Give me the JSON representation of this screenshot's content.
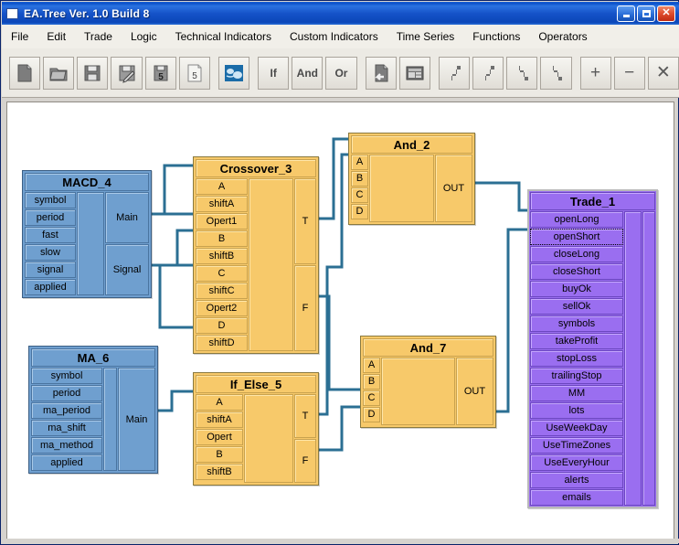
{
  "window": {
    "title": "EA.Tree Ver. 1.0 Build 8",
    "minimize_label": "Minimize",
    "maximize_label": "Maximize",
    "close_label": "Close"
  },
  "menubar": {
    "items": [
      {
        "label": "File"
      },
      {
        "label": "Edit"
      },
      {
        "label": "Trade"
      },
      {
        "label": "Logic"
      },
      {
        "label": "Technical Indicators"
      },
      {
        "label": "Custom Indicators"
      },
      {
        "label": "Time Series"
      },
      {
        "label": "Functions"
      },
      {
        "label": "Operators"
      }
    ]
  },
  "toolbar": {
    "buttons": [
      {
        "icon": "new-file-icon",
        "label": ""
      },
      {
        "icon": "open-folder-icon",
        "label": ""
      },
      {
        "icon": "save-icon",
        "label": ""
      },
      {
        "icon": "save-as-icon",
        "label": ""
      },
      {
        "icon": "save-5-icon",
        "label": "5"
      },
      {
        "icon": "page-5-icon",
        "label": "5"
      },
      {
        "icon": "globe-icon",
        "label": ""
      },
      {
        "icon": "if-icon",
        "label": "If"
      },
      {
        "icon": "and-icon",
        "label": "And"
      },
      {
        "icon": "or-icon",
        "label": "Or"
      },
      {
        "icon": "return-doc-icon",
        "label": ""
      },
      {
        "icon": "table-icon",
        "label": ""
      },
      {
        "icon": "step-up-icon",
        "label": ""
      },
      {
        "icon": "step-up2-icon",
        "label": ""
      },
      {
        "icon": "step-down-icon",
        "label": ""
      },
      {
        "icon": "step-down2-icon",
        "label": ""
      },
      {
        "icon": "plus-icon",
        "label": "+"
      },
      {
        "icon": "minus-icon",
        "label": "−"
      },
      {
        "icon": "delete-x-icon",
        "label": "✕"
      }
    ]
  },
  "colors": {
    "indicator_node": "#6f9fcf",
    "logic_node": "#f7c96a",
    "trade_node": "#9a6ef0",
    "wire": "#2b6f93",
    "titlebar": "#0a50c8",
    "canvas": "#ffffff"
  },
  "canvas": {
    "nodes": [
      {
        "id": "macd4",
        "title": "MACD_4",
        "type": "indicator",
        "inputs": [
          "symbol",
          "period",
          "fast",
          "slow",
          "signal",
          "applied"
        ],
        "outputs": [
          "Main",
          "Signal"
        ]
      },
      {
        "id": "crossover3",
        "title": "Crossover_3",
        "type": "logic",
        "inputs": [
          "A",
          "shiftA",
          "Opert1",
          "B",
          "shiftB",
          "C",
          "shiftC",
          "Opert2",
          "D",
          "shiftD"
        ],
        "outputs": [
          "T",
          "F"
        ]
      },
      {
        "id": "and2",
        "title": "And_2",
        "type": "logic",
        "inputs": [
          "A",
          "B",
          "C",
          "D"
        ],
        "outputs": [
          "OUT"
        ]
      },
      {
        "id": "ma6",
        "title": "MA_6",
        "type": "indicator",
        "inputs": [
          "symbol",
          "period",
          "ma_period",
          "ma_shift",
          "ma_method",
          "applied"
        ],
        "outputs": [
          "Main"
        ]
      },
      {
        "id": "ifelse5",
        "title": "If_Else_5",
        "type": "logic",
        "inputs": [
          "A",
          "shiftA",
          "Opert",
          "B",
          "shiftB"
        ],
        "outputs": [
          "T",
          "F"
        ]
      },
      {
        "id": "and7",
        "title": "And_7",
        "type": "logic",
        "inputs": [
          "A",
          "B",
          "C",
          "D"
        ],
        "outputs": [
          "OUT"
        ]
      },
      {
        "id": "trade1",
        "title": "Trade_1",
        "type": "trade",
        "selected": true,
        "selected_port": "openShort",
        "inputs": [
          "openLong",
          "openShort",
          "closeLong",
          "closeShort",
          "buyOk",
          "sellOk",
          "symbols",
          "takeProfit",
          "stopLoss",
          "trailingStop",
          "MM",
          "lots",
          "UseWeekDay",
          "UseTimeZones",
          "UseEveryHour",
          "alerts",
          "emails"
        ],
        "outputs": []
      }
    ],
    "connections": [
      {
        "from": "macd4.Main",
        "to": "crossover3.A"
      },
      {
        "from": "macd4.Main",
        "to": "crossover3.B"
      },
      {
        "from": "macd4.Signal",
        "to": "crossover3.C"
      },
      {
        "from": "macd4.Signal",
        "to": "crossover3.D"
      },
      {
        "from": "crossover3.T",
        "to": "and2.A"
      },
      {
        "from": "crossover3.F",
        "to": "and7.A"
      },
      {
        "from": "ma6.Main",
        "to": "ifelse5.A"
      },
      {
        "from": "ifelse5.T",
        "to": "and2.B"
      },
      {
        "from": "ifelse5.F",
        "to": "and7.B"
      },
      {
        "from": "and2.OUT",
        "to": "trade1.openLong"
      },
      {
        "from": "and7.OUT",
        "to": "trade1.openShort"
      }
    ]
  }
}
